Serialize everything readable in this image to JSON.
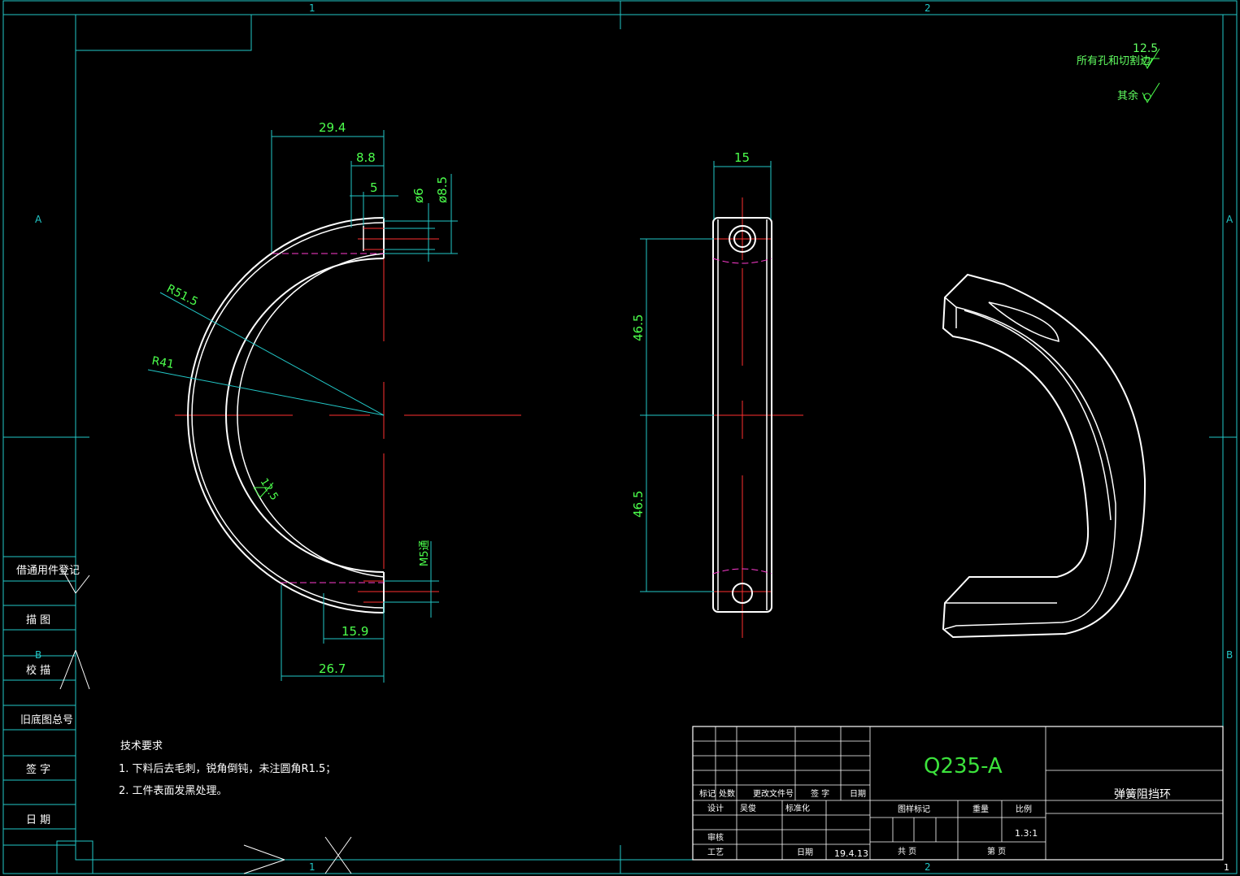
{
  "frame": {
    "zone_cols": [
      "1",
      "2"
    ],
    "zone_rows": [
      "A",
      "B"
    ],
    "corner_mark": "1"
  },
  "roughness": {
    "note_label": "所有孔和切割边",
    "note_value": "12.5",
    "other_label": "其余"
  },
  "front_view": {
    "dims": {
      "w_294": "29.4",
      "w_88": "8.8",
      "w_5": "5",
      "d_6": "ø6",
      "d_85": "ø8.5",
      "r_515": "R51.5",
      "r_41": "R41",
      "rough_inner": "12.5",
      "thread": "M5通",
      "w_159": "15.9",
      "w_267": "26.7"
    }
  },
  "side_view": {
    "dims": {
      "w_15": "15",
      "h_upper": "46.5",
      "h_lower": "46.5"
    }
  },
  "left_strip": {
    "items": [
      "借通用件登记",
      "描 图",
      "校 描",
      "旧底图总号",
      "签 字",
      "日 期"
    ]
  },
  "tech_notes": {
    "title": "技术要求",
    "lines": [
      "1. 下料后去毛刺，锐角倒钝，未注圆角R1.5；",
      "2. 工件表面发黑处理。"
    ]
  },
  "title_block": {
    "material": "Q235-A",
    "part_name": "弹簧阻挡环",
    "rev_headers": [
      "标记",
      "处数",
      "更改文件号",
      "签 字",
      "日期"
    ],
    "design_label": "设计",
    "designer": "吴俊",
    "std_label": "标准化",
    "review_label": "审核",
    "process_label": "工艺",
    "date_label": "日期",
    "date_value": "19.4.13",
    "stage_label": "图样标记",
    "weight_label": "重量",
    "scale_label": "比例",
    "scale_value": "1.3:1",
    "sheets_label": "共 页",
    "sheet_label": "第 页"
  }
}
